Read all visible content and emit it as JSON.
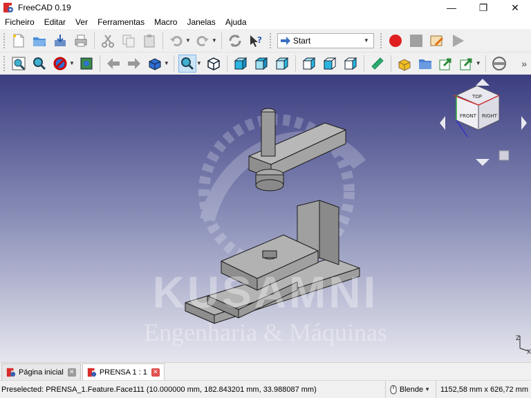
{
  "window": {
    "title": "FreeCAD 0.19",
    "minimize": "—",
    "maximize": "❐",
    "close": "✕"
  },
  "menu": [
    "Ficheiro",
    "Editar",
    "Ver",
    "Ferramentas",
    "Macro",
    "Janelas",
    "Ajuda"
  ],
  "toolbar": {
    "workbench_selected": "Start"
  },
  "viewport": {
    "watermark_brand": "KUSAMNI",
    "watermark_sub": "Engenharia & Máquinas",
    "navcube_faces": {
      "top": "TOP",
      "front": "FRONT",
      "right": "RIGHT"
    }
  },
  "tabs": [
    {
      "label": "Página inicial",
      "active": false
    },
    {
      "label": "PRENSA 1 : 1",
      "active": true
    }
  ],
  "status": {
    "message": "Preselected: PRENSA_1.Feature.Face111 (10.000000 mm, 182.843201 mm, 33.988087 mm)",
    "nav_style": "Blende",
    "dimensions": "1152,58 mm x 626,72 mm"
  },
  "colors": {
    "accent_red": "#e03030",
    "viewport_top": "#3b3d80",
    "viewport_bottom": "#e6e6ee",
    "part_gray": "#a9a9a9"
  }
}
